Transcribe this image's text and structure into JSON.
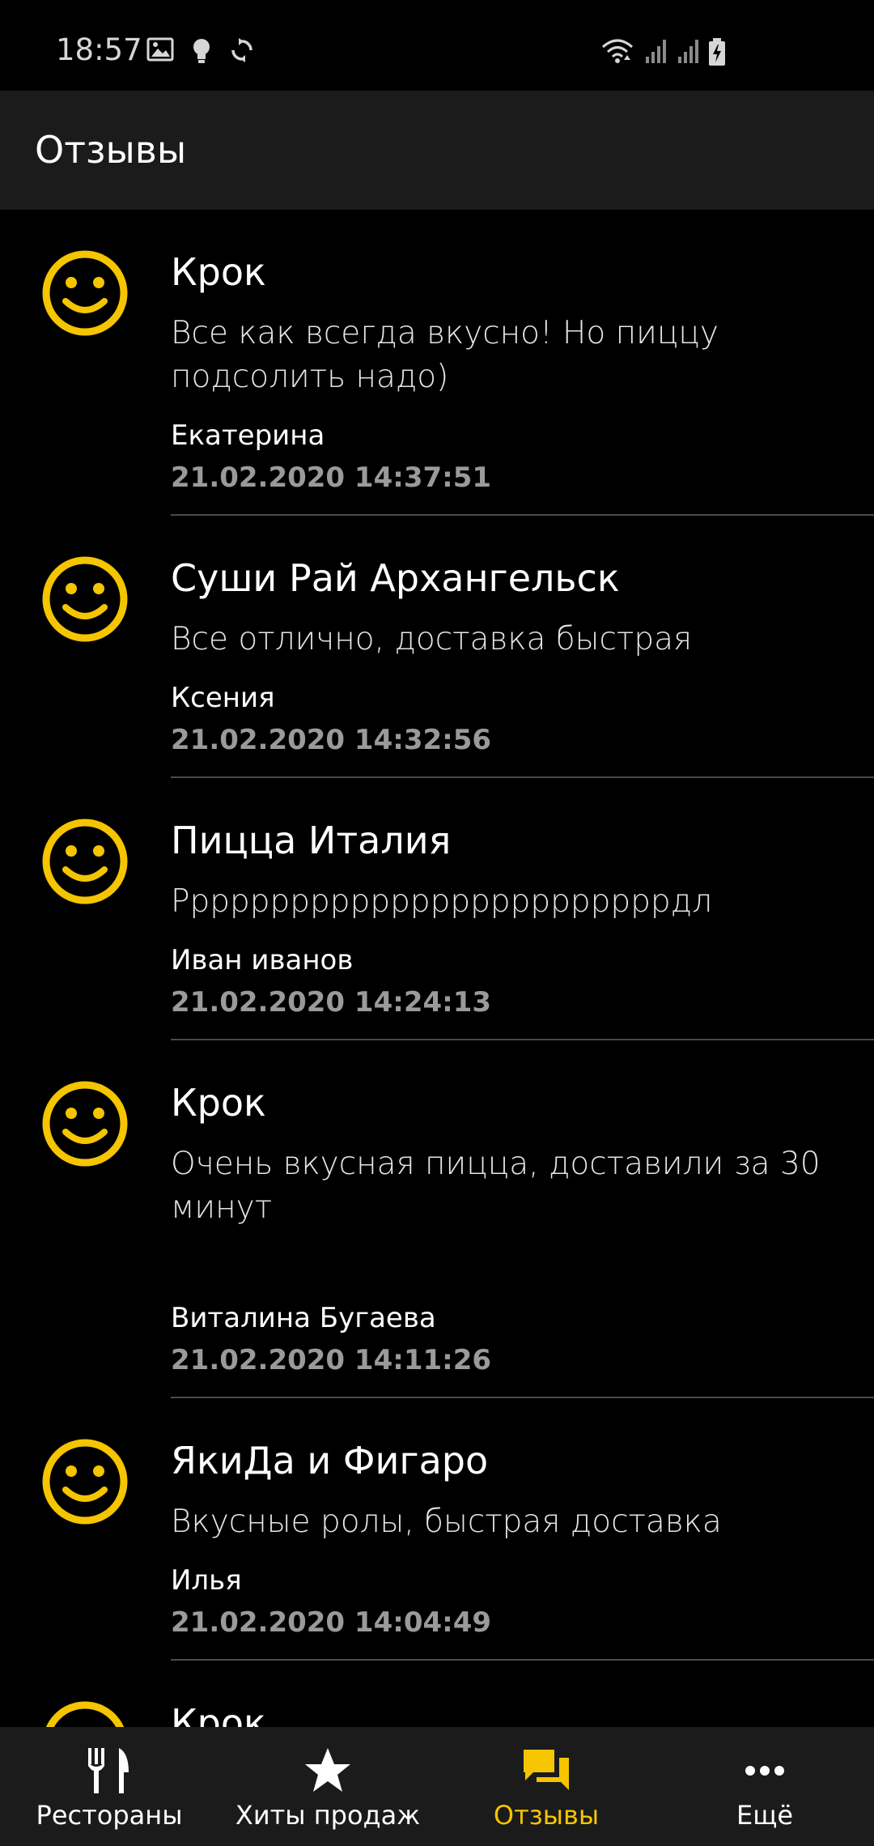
{
  "colors": {
    "background": "#000000",
    "app_bar": "#1b1b1b",
    "accent": "#f4c500",
    "date_text": "#9a9a9a",
    "divider": "#4a4a4a"
  },
  "status_bar": {
    "time": "18:57",
    "icons": [
      "image-icon",
      "bulb-icon",
      "sync-icon",
      "wifi-icon",
      "signal-icon",
      "signal-icon",
      "battery-charging-icon"
    ]
  },
  "app_bar": {
    "title": "Отзывы"
  },
  "reviews": [
    {
      "avatar_icon": "smiley-icon",
      "restaurant": "Крок",
      "text": "Все как всегда вкусно! Но пиццу подсолить надо)",
      "author": "Екатерина",
      "date": "21.02.2020 14:37:51"
    },
    {
      "avatar_icon": "smiley-icon",
      "restaurant": "Суши Рай Архангельск",
      "text": "Все отлично, доставка быстрая",
      "author": "Ксения",
      "date": "21.02.2020 14:32:56"
    },
    {
      "avatar_icon": "smiley-icon",
      "restaurant": "Пицца Италия",
      "text": "Рррррррррррррррррррррррррдл",
      "author": "Иван иванов",
      "date": "21.02.2020 14:24:13"
    },
    {
      "avatar_icon": "smiley-icon",
      "restaurant": "Крок",
      "text": "Очень вкусная пицца, доставили за 30 минут",
      "author": "Виталина Бугаева",
      "date": "21.02.2020 14:11:26"
    },
    {
      "avatar_icon": "smiley-icon",
      "restaurant": "ЯкиДа и Фигаро",
      "text": "Вкусные ролы, быстрая доставка",
      "author": "Илья",
      "date": "21.02.2020 14:04:49"
    },
    {
      "avatar_icon": "smiley-icon",
      "restaurant": "Крок"
    }
  ],
  "bottom_nav": {
    "items": [
      {
        "label": "Рестораны",
        "icon": "fork-knife-icon",
        "active": false
      },
      {
        "label": "Хиты продаж",
        "icon": "star-icon",
        "active": false
      },
      {
        "label": "Отзывы",
        "icon": "chat-bubbles-icon",
        "active": true
      },
      {
        "label": "Ещё",
        "icon": "more-dots-icon",
        "active": false
      }
    ]
  }
}
